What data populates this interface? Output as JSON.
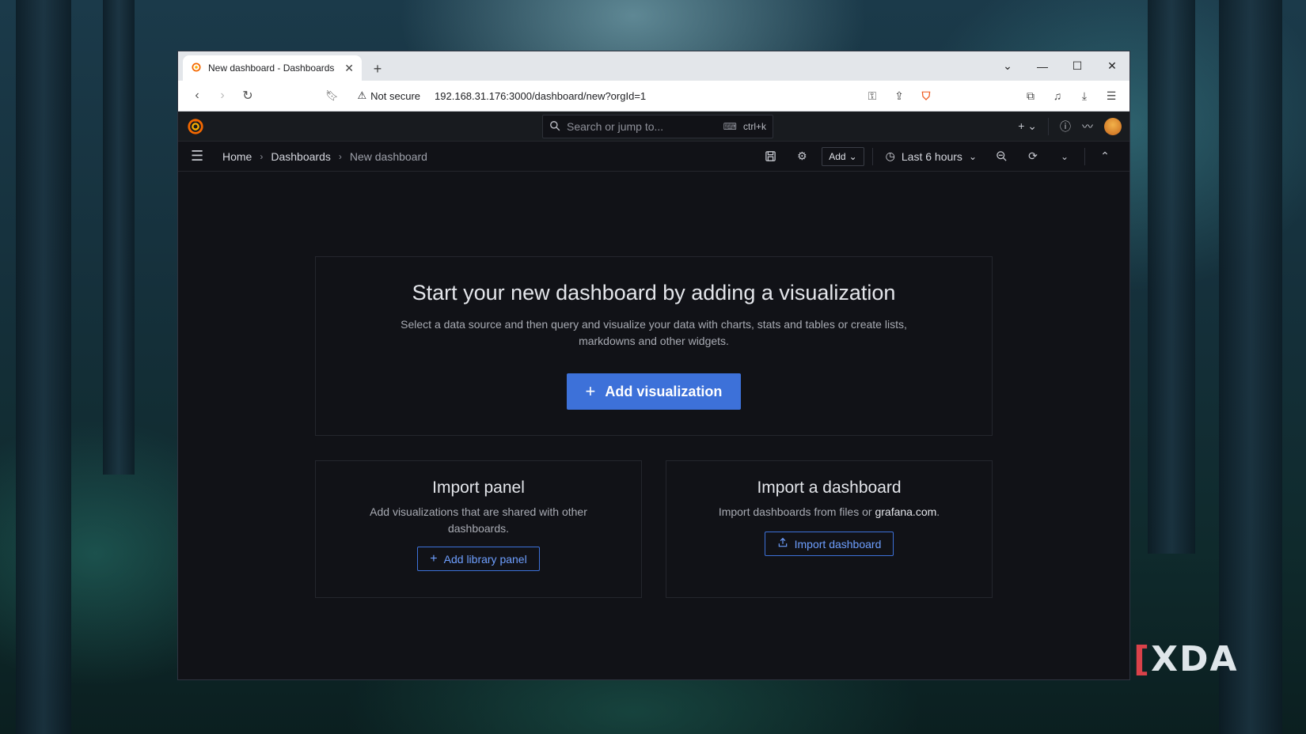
{
  "browser": {
    "tab_title": "New dashboard - Dashboards",
    "new_tab_symbol": "+",
    "not_secure_label": "Not secure",
    "url": "192.168.31.176:3000/dashboard/new?orgId=1"
  },
  "topnav": {
    "search_placeholder": "Search or jump to...",
    "search_shortcut": "ctrl+k"
  },
  "breadcrumb": {
    "home": "Home",
    "dashboards": "Dashboards",
    "current": "New dashboard"
  },
  "toolbar": {
    "add_label": "Add",
    "time_range": "Last 6 hours"
  },
  "empty_state": {
    "title": "Start your new dashboard by adding a visualization",
    "description": "Select a data source and then query and visualize your data with charts, stats and tables or create lists, markdowns and other widgets.",
    "add_visualization_label": "Add visualization"
  },
  "import_panel": {
    "title": "Import panel",
    "description": "Add visualizations that are shared with other dashboards.",
    "button_label": "Add library panel"
  },
  "import_dashboard": {
    "title": "Import a dashboard",
    "description_prefix": "Import dashboards from files or",
    "link_text": "grafana.com",
    "description_suffix": ".",
    "button_label": "Import dashboard"
  },
  "watermark": {
    "text": "XDA"
  },
  "colors": {
    "primary_button": "#3d71d9",
    "outline_button_text": "#6e9fff",
    "grafana_orange": "#f46800",
    "page_background": "#111217"
  }
}
